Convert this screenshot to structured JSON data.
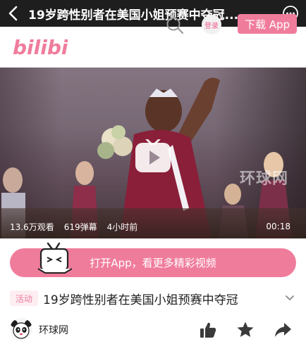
{
  "topbar": {
    "title": "19岁跨性别者在美国小姐预赛中夺冠..."
  },
  "header": {
    "logo_text": "bilibili",
    "login_label": "登录",
    "download_label": "下载 App"
  },
  "video": {
    "watermark": "环球网",
    "views": "13.6万观看",
    "danmaku": "619弹幕",
    "time_ago": "4小时前",
    "duration": "00:18"
  },
  "open_app": {
    "label": "打开App，看更多精彩视频"
  },
  "info": {
    "tag": "活动",
    "title": "19岁跨性别者在美国小姐预赛中夺冠"
  },
  "author": {
    "name": "环球网"
  },
  "colors": {
    "brand_pink": "#f07c9c",
    "topbar_bg": "#1e1e1e"
  },
  "icons": [
    "back-icon",
    "more-icon",
    "search-icon",
    "play-icon",
    "chevron-down-icon",
    "like-icon",
    "favorite-icon",
    "share-icon"
  ]
}
